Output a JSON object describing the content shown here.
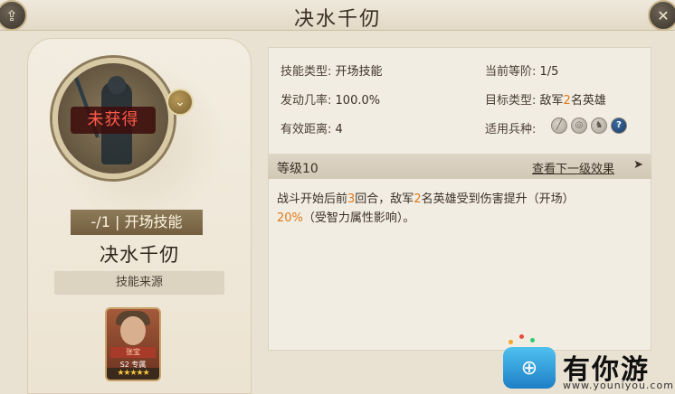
{
  "window": {
    "title": "决水千仞",
    "share_icon": "share-icon",
    "close_icon": "close-icon"
  },
  "skill_card": {
    "status": "未获得",
    "level_type": "-/1 | 开场技能",
    "name": "决水千仞",
    "source_button": "技能来源",
    "hero": {
      "name": "张宝",
      "sub": "S2 专属",
      "stars": "★★★★★"
    }
  },
  "attributes": {
    "skill_type_label": "技能类型:",
    "skill_type_value": "开场技能",
    "current_rank_label": "当前等阶:",
    "current_rank_value": "1/5",
    "trigger_rate_label": "发动几率:",
    "trigger_rate_value": "100.0%",
    "target_label": "目标类型:",
    "target_value_prefix": "敌军",
    "target_value_num": "2",
    "target_value_suffix": "名英雄",
    "range_label": "有效距离:",
    "range_value": "4",
    "troop_label": "适用兵种:",
    "troop_icons": [
      "spear-icon",
      "bow-icon",
      "horse-icon",
      "help-icon"
    ]
  },
  "level_bar": {
    "label": "等级10",
    "next_link": "查看下一级效果",
    "arrow": "➤"
  },
  "description": {
    "p1": "战斗开始后前",
    "n1": "3",
    "p2": "回合，敌军",
    "n2": "2",
    "p3": "名英雄受到伤害提升（开场）",
    "n3": "20%",
    "p4": "（受智力属性影响）。"
  },
  "watermark": {
    "name": "有你游",
    "url": "www.youniyou.com"
  },
  "colors": {
    "highlight": "#e07a18",
    "unobtained": "#ff5a4a"
  }
}
